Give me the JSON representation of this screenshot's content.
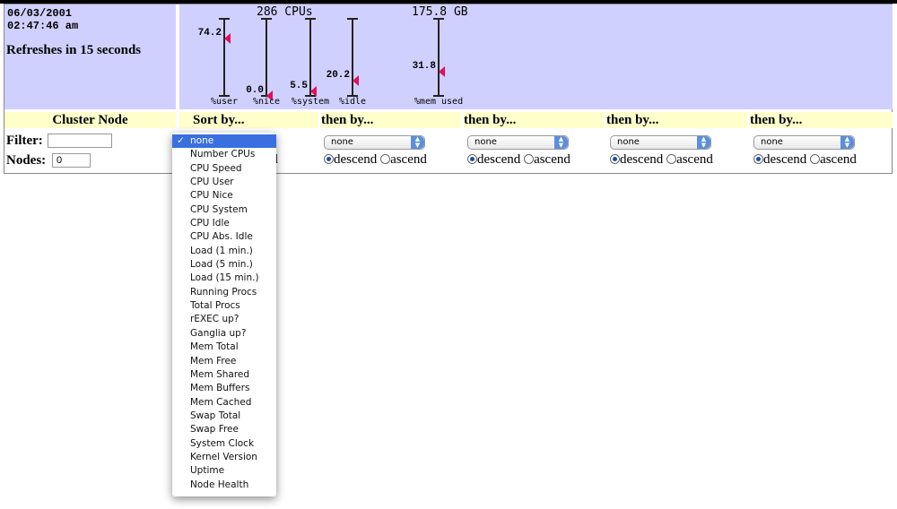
{
  "status": {
    "date": "06/03/2001",
    "time": "02:47:46 am",
    "refresh": "Refreshes in 15 seconds"
  },
  "cpu_title": "286 CPUs",
  "mem_title": "175.8 GB",
  "gauges": [
    {
      "label": "%user",
      "value": 74.2,
      "display": "74.2"
    },
    {
      "label": "%nice",
      "value": 0.0,
      "display": "0.0"
    },
    {
      "label": "%system",
      "value": 5.5,
      "display": "5.5"
    },
    {
      "label": "%idle",
      "value": 20.2,
      "display": "20.2"
    },
    {
      "label": "%mem used",
      "value": 31.8,
      "display": "31.8"
    }
  ],
  "headers": {
    "cluster_node": "Cluster Node",
    "sort_by": "Sort by...",
    "then_by": "then by..."
  },
  "filter": {
    "label": "Filter:",
    "value": ""
  },
  "nodes": {
    "label": "Nodes:",
    "value": "0"
  },
  "sort_selects": [
    "none",
    "none",
    "none",
    "none",
    "none"
  ],
  "radio": {
    "descend": "descend",
    "ascend": "ascend"
  },
  "dropdown_options": [
    "none",
    "Number CPUs",
    "CPU Speed",
    "CPU User",
    "CPU Nice",
    "CPU System",
    "CPU Idle",
    "CPU Abs. Idle",
    "Load (1 min.)",
    "Load (5 min.)",
    "Load (15 min.)",
    "Running Procs",
    "Total Procs",
    "rEXEC up?",
    "Ganglia up?",
    "Mem Total",
    "Mem Free",
    "Mem Shared",
    "Mem Buffers",
    "Mem Cached",
    "Swap Total",
    "Swap Free",
    "System Clock",
    "Kernel Version",
    "Uptime",
    "Node Health"
  ]
}
